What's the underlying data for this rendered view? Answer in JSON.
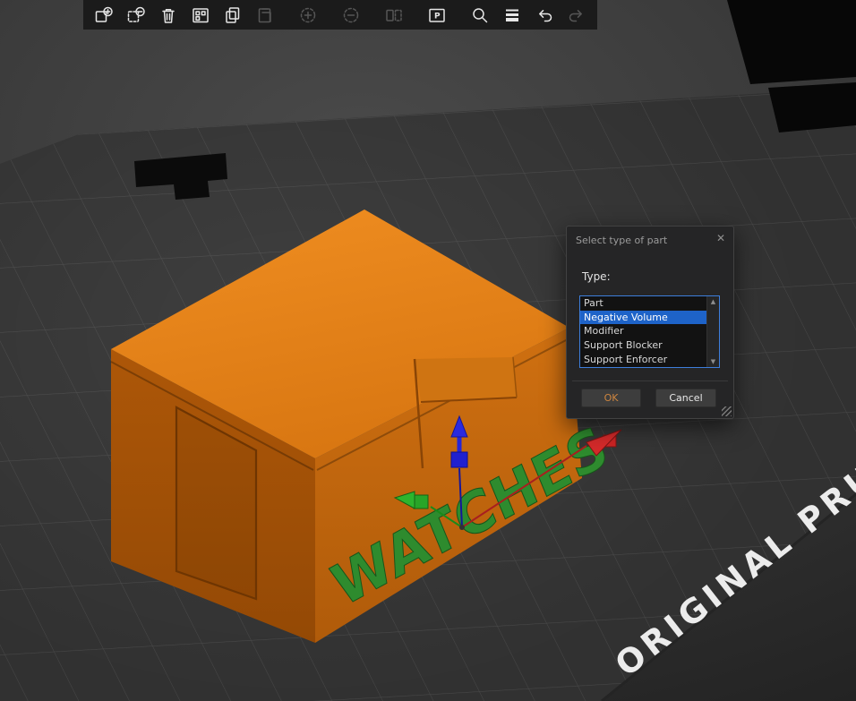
{
  "toolbar": {
    "icons": [
      {
        "name": "add-object",
        "enabled": true
      },
      {
        "name": "delete-object",
        "enabled": true
      },
      {
        "name": "delete-all",
        "enabled": true
      },
      {
        "name": "arrange",
        "enabled": true
      },
      {
        "name": "copy",
        "enabled": true
      },
      {
        "name": "paste",
        "enabled": false
      },
      {
        "name": "add-instance",
        "enabled": false
      },
      {
        "name": "remove-instance",
        "enabled": false
      },
      {
        "name": "split-to-objects",
        "enabled": false
      },
      {
        "name": "split-to-parts",
        "enabled": true
      },
      {
        "name": "search",
        "enabled": true
      },
      {
        "name": "variable-layer-height",
        "enabled": true
      },
      {
        "name": "undo",
        "enabled": true
      },
      {
        "name": "redo",
        "enabled": false
      }
    ],
    "split_parts_glyph": "P"
  },
  "dialog": {
    "title": "Select type of part",
    "close_label": "✕",
    "type_label": "Type:",
    "list": {
      "items": [
        {
          "label": "Part",
          "selected": false
        },
        {
          "label": "Negative Volume",
          "selected": true
        },
        {
          "label": "Modifier",
          "selected": false
        },
        {
          "label": "Support Blocker",
          "selected": false
        },
        {
          "label": "Support Enforcer",
          "selected": false
        }
      ],
      "scrollbar": {
        "up": "▲",
        "down": "▼"
      }
    },
    "buttons": {
      "ok": "OK",
      "cancel": "Cancel"
    }
  },
  "scene": {
    "bed_text": "ORIGINAL PRUSA",
    "model_text": "WATCHES",
    "colors": {
      "model_top": "#e6831d",
      "model_left": "#aa5507",
      "model_right": "#cd6f10",
      "bed": "#313131",
      "grid": "#484848",
      "selection_blue": "#1e63c8",
      "ok_text": "#cd853f",
      "label_green": "#2e8b2e",
      "axis_x_red": "#cc2424",
      "axis_y_green": "#28a528",
      "axis_z_blue": "#2525d8"
    }
  }
}
